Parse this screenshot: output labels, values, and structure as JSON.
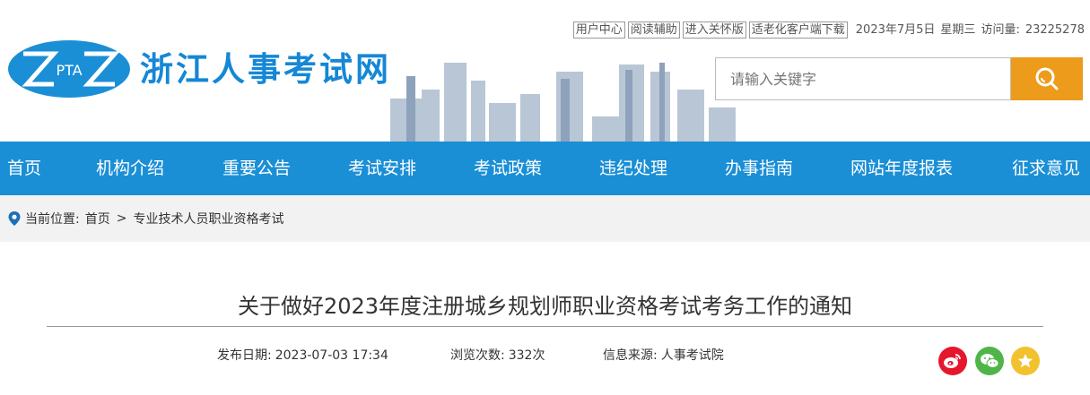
{
  "header": {
    "logo_text": "PTA",
    "site_name": "浙江人事考试网",
    "top_links": [
      "用户中心",
      "阅读辅助",
      "进入关怀版",
      "适老化客户端下载"
    ],
    "date": "2023年7月5日",
    "weekday": "星期三",
    "visits_label": "访问量:",
    "visits_count": "23225278"
  },
  "search": {
    "placeholder": "请输入关键字",
    "button_icon": "search-icon"
  },
  "nav": {
    "items": [
      "首页",
      "机构介绍",
      "重要公告",
      "考试安排",
      "考试政策",
      "违纪处理",
      "办事指南",
      "网站年度报表",
      "征求意见"
    ]
  },
  "breadcrumb": {
    "label": "当前位置:",
    "home": "首页",
    "separator": ">",
    "current": "专业技术人员职业资格考试"
  },
  "article": {
    "title": "关于做好2023年度注册城乡规划师职业资格考试考务工作的通知",
    "publish_date_label": "发布日期:",
    "publish_date": "2023-07-03 17:34",
    "views_label": "浏览次数:",
    "views": "332次",
    "source_label": "信息来源:",
    "source": "人事考试院"
  },
  "share": {
    "icons": [
      "weibo-icon",
      "wechat-icon",
      "favorite-star-icon"
    ]
  },
  "colors": {
    "brand_blue": "#1b8fd6",
    "search_button": "#ec9b1b",
    "weibo_red": "#e6162d",
    "wechat_green": "#50b548",
    "star_yellow": "#f2c12e"
  }
}
